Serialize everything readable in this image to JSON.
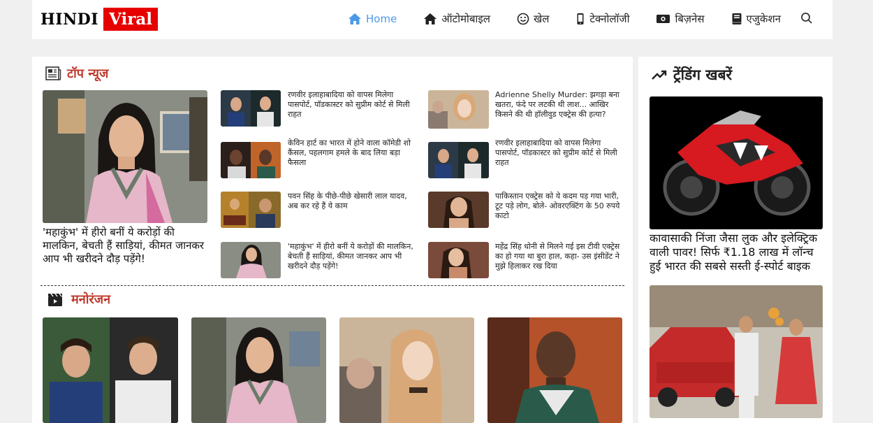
{
  "brand": {
    "part1": "HINDI",
    "part2": "Viral",
    "accent": "#e60000"
  },
  "nav": [
    {
      "label": "Home",
      "icon": "home-icon",
      "active": true
    },
    {
      "label": "ऑटोमोबाइल",
      "icon": "car-icon"
    },
    {
      "label": "खेल",
      "icon": "smile-icon"
    },
    {
      "label": "टेक्नोलॉजी",
      "icon": "phone-icon"
    },
    {
      "label": "बिज़नेस",
      "icon": "money-icon"
    },
    {
      "label": "एजुकेशन",
      "icon": "book-icon"
    }
  ],
  "top_news": {
    "title": "टॉप न्यूज",
    "featured": "'महाकुंभ' में हीरो बनीं ये करोड़ों की मालकिन, बेचती हैं साड़ियां, कीमत जानकर आप भी खरीदने दौड़ पड़ेंगे!",
    "items": [
      "रणवीर इलाहाबादिया को वापस मिलेगा पासपोर्ट, पॉडकास्टर को सुप्रीम कोर्ट से मिली राहत",
      "Adrienne Shelly Murder: झगड़ा बना खतरा, फंदे पर लटकी थी लाश... आखिर किसने की थी हॉलीवुड एक्ट्रेस की हत्या?",
      "केविन हार्ट का भारत में होने वाला कॉमेडी शो कैंसल, पहलगाम हमले के बाद लिया बड़ा फैसला",
      "रणवीर इलाहाबादिया को वापस मिलेगा पासपोर्ट, पॉडकास्टर को सुप्रीम कोर्ट से मिली राहत",
      "पवन सिंह के पीछे-पीछे खेसारी लाल यादव, अब कर रहे हैं ये काम",
      "पाकिस्तान एक्ट्रेस को ये कदम पड़ गया भारी, टूट पड़े लोग, बोले- ओवरएक्टिंग के 50 रुपये काटो",
      "'महाकुंभ' में हीरो बनीं ये करोड़ों की मालकिन, बेचती हैं साड़ियां, कीमत जानकर आप भी खरीदने दौड़ पड़ेंगे!",
      "महेंद्र सिंह धोनी से मिलने गई इस टीवी एक्ट्रेस का हो गया था बुरा हाल, कहा- उस इंसीडेंट ने मुझे हिलाकर रख दिया"
    ]
  },
  "entertainment": {
    "title": "मनोरंजन"
  },
  "trending": {
    "title": "ट्रेंडिंग खबरें",
    "items": [
      "कावासाकी निंजा जैसा लुक और इलेक्ट्रिक वाली पावर! सिर्फ ₹1.18 लाख में लॉन्च हुई भारत की सबसे सस्ती ई-स्पोर्ट बाइक"
    ]
  }
}
